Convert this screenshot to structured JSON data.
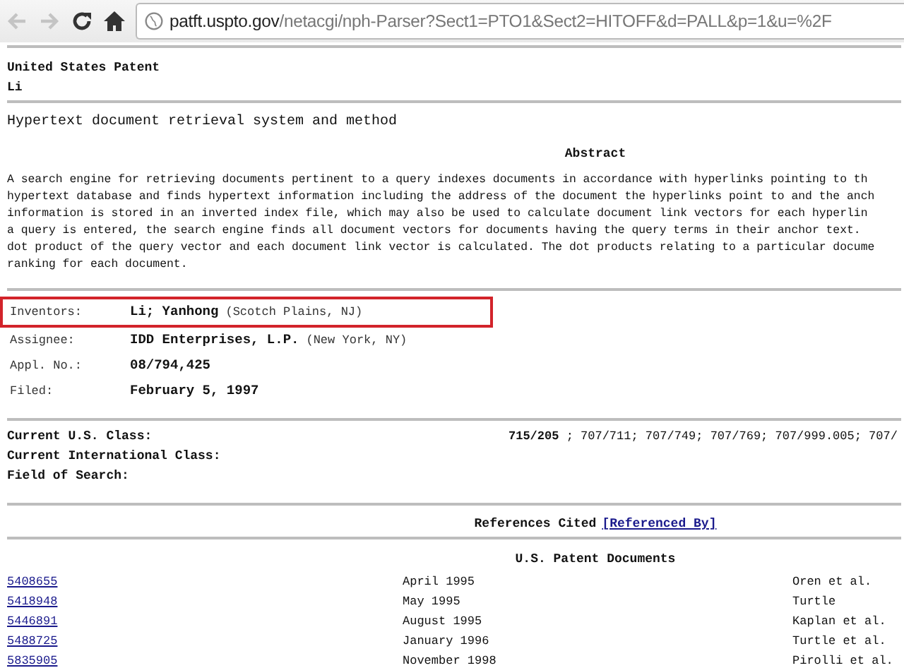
{
  "browser": {
    "address_host": "patft.uspto.gov",
    "address_path": "/netacgi/nph-Parser?Sect1=PTO1&Sect2=HITOFF&d=PALL&p=1&u=%2F",
    "back_disabled": true,
    "forward_disabled": true
  },
  "header": {
    "kind_line": "United States Patent",
    "inventor_short": "Li"
  },
  "title": "Hypertext document retrieval system and method",
  "abstract": {
    "heading": "Abstract",
    "lines": [
      "A search engine for retrieving documents pertinent to a query indexes documents in accordance with hyperlinks pointing to th",
      "hypertext database and finds hypertext information including the address of the document the hyperlinks point to and the anch",
      "information is stored in an inverted index file, which may also be used to calculate document link vectors for each hyperlin",
      "a query is entered, the search engine finds all document vectors for documents having the query terms in their anchor text.",
      "dot product of the query vector and each document link vector is calculated. The dot products relating to a particular docume",
      "ranking for each document."
    ]
  },
  "fields": [
    {
      "label": "Inventors:",
      "value": "Li; Yanhong",
      "note": "(Scotch Plains, NJ)",
      "highlighted": true
    },
    {
      "label": "Assignee:",
      "value": "IDD Enterprises, L.P.",
      "note": "(New York, NY)",
      "highlighted": false
    },
    {
      "label": "Appl. No.:",
      "value": "08/794,425",
      "highlighted": false
    },
    {
      "label": "Filed:",
      "value": "February 5, 1997",
      "highlighted": false
    }
  ],
  "classes": [
    {
      "label": "Current U.S. Class:",
      "value": "**715/205** ; 707/711; 707/749; 707/769; 707/999.005; 707/"
    },
    {
      "label": "Current International Class:"
    },
    {
      "label": "Field of Search:"
    }
  ],
  "references": {
    "heading": "References Cited",
    "link": "[Referenced By]",
    "subheading": "U.S. Patent Documents",
    "rows": [
      {
        "number": "5408655",
        "date": "April 1995",
        "inventor": "Oren et al."
      },
      {
        "number": "5418948",
        "date": "May 1995",
        "inventor": "Turtle"
      },
      {
        "number": "5446891",
        "date": "August 1995",
        "inventor": "Kaplan et al."
      },
      {
        "number": "5488725",
        "date": "January 1996",
        "inventor": "Turtle et al."
      },
      {
        "number": "5835905",
        "date": "November 1998",
        "inventor": "Pirolli et al."
      }
    ]
  }
}
